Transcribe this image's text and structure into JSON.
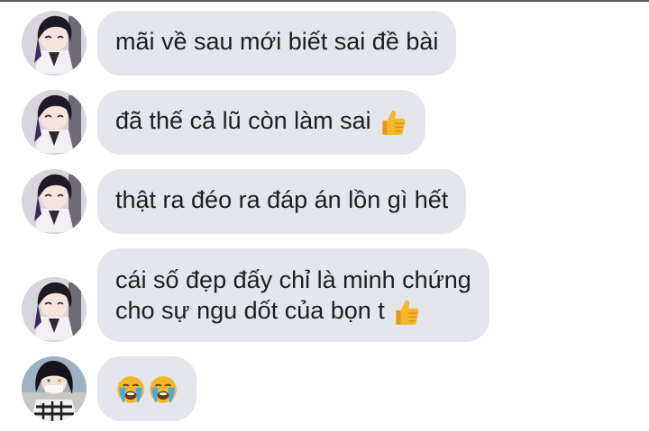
{
  "messages": [
    {
      "sender": "shinobu",
      "lines": [
        "mãi về sau mới biết sai đề bài"
      ]
    },
    {
      "sender": "shinobu",
      "lines": [
        "đã thế cả lũ còn làm sai"
      ],
      "trailing_emoji": "thumbs-up"
    },
    {
      "sender": "shinobu",
      "lines": [
        "thật ra đéo ra đáp án lồn gì hết"
      ]
    },
    {
      "sender": "shinobu",
      "lines": [
        "cái số đẹp đấy chỉ là minh chứng",
        "cho sự ngu dốt của bọn t"
      ],
      "trailing_emoji": "thumbs-up"
    },
    {
      "sender": "obanai",
      "lines": [],
      "emojis": [
        "loudly-crying-face",
        "loudly-crying-face"
      ]
    }
  ],
  "colors": {
    "bubble_bg": "#e4e6eb",
    "text": "#1c1e21",
    "emoji_yellow": "#f5b72a",
    "emoji_tears": "#4aa8e8"
  }
}
